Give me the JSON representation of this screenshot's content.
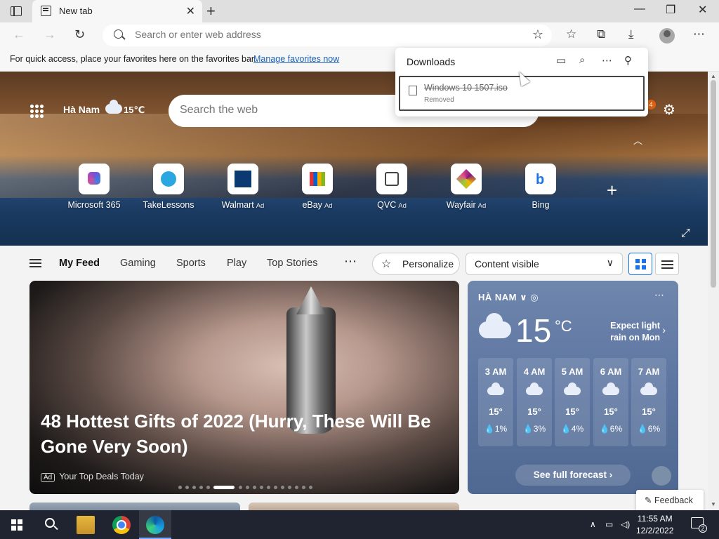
{
  "browser": {
    "tab_title": "New tab",
    "address_placeholder": "Search or enter web address"
  },
  "favorites_bar": {
    "message": "For quick access, place your favorites here on the favorites bar.",
    "link": "Manage favorites now"
  },
  "downloads": {
    "title": "Downloads",
    "items": [
      {
        "name": "Windows 10 1507.iso",
        "status": "Removed"
      }
    ]
  },
  "hero": {
    "location": "Hà Nam",
    "temperature": "15℃",
    "search_placeholder": "Search the web",
    "notification_count": "4",
    "quick_links": [
      {
        "label": "Microsoft 365",
        "ad": ""
      },
      {
        "label": "TakeLessons",
        "ad": ""
      },
      {
        "label": "Walmart",
        "ad": "Ad"
      },
      {
        "label": "eBay",
        "ad": "Ad"
      },
      {
        "label": "QVC",
        "ad": "Ad"
      },
      {
        "label": "Wayfair",
        "ad": "Ad"
      },
      {
        "label": "Bing",
        "ad": ""
      }
    ]
  },
  "feed_nav": {
    "items": [
      "My Feed",
      "Gaming",
      "Sports",
      "Play",
      "Top Stories"
    ],
    "personalize": "Personalize",
    "content_visibility": "Content visible"
  },
  "main_card": {
    "headline": "48 Hottest Gifts of 2022 (Hurry, These Will Be Gone Very Soon)",
    "ad_label": "Ad",
    "source": "Your Top Deals Today"
  },
  "weather": {
    "location": "HÀ NAM",
    "temp": "15",
    "unit": "°C",
    "forecast_line1": "Expect light",
    "forecast_line2": "rain on Mon",
    "hours": [
      {
        "time": "3 AM",
        "temp": "15°",
        "precip": "1%"
      },
      {
        "time": "4 AM",
        "temp": "15°",
        "precip": "3%"
      },
      {
        "time": "5 AM",
        "temp": "15°",
        "precip": "4%"
      },
      {
        "time": "6 AM",
        "temp": "15°",
        "precip": "6%"
      },
      {
        "time": "7 AM",
        "temp": "15°",
        "precip": "6%"
      }
    ],
    "full_forecast": "See full forecast"
  },
  "feedback": "Feedback",
  "taskbar": {
    "time": "11:55 AM",
    "date": "12/2/2022",
    "notifications": "2"
  }
}
